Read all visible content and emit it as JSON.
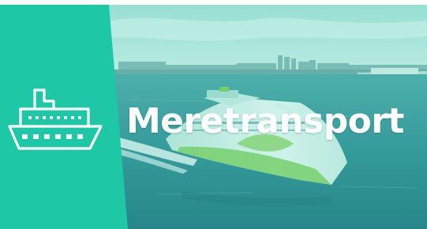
{
  "banner": {
    "title": "Meretransport",
    "icon": "cruise-ship-icon",
    "accent_color": "#1ec7a6",
    "tint_color": "#5fd3c2"
  }
}
